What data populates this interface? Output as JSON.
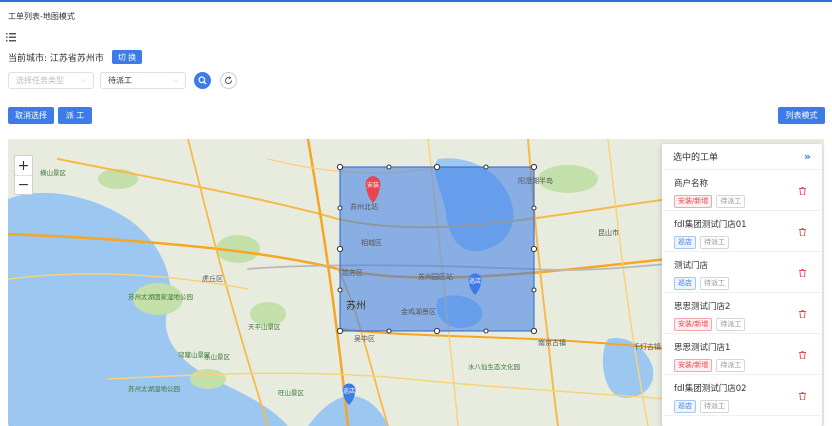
{
  "breadcrumb": "工单列表-地图模式",
  "city": {
    "label": "当前城市: 江苏省苏州市",
    "switch_label": "切 换"
  },
  "filters": {
    "task_type_placeholder": "选择任务类型",
    "status_value": "待派工"
  },
  "actions": {
    "cancel_select": "取消选择",
    "dispatch": "派 工",
    "list_mode": "列表模式"
  },
  "map": {
    "pins": [
      {
        "label": "安装",
        "color": "#e8454f"
      },
      {
        "label": "巡店",
        "color": "#3c7be8"
      },
      {
        "label": "巡店",
        "color": "#3c7be8"
      }
    ],
    "places": [
      "苏州北站",
      "相城区",
      "姑苏区",
      "苏州园区站",
      "金鸡湖景区",
      "苏州",
      "吴中区",
      "东山景区",
      "苏州太湖国家湿地公园",
      "旺山景区",
      "阳澄湖半岛",
      "昆山市",
      "虎丘区",
      "南京古镇",
      "千灯古镇",
      "水八仙生态文化园",
      "横山景区",
      "苏州太湖湿地公园",
      "穹窿山景区",
      "天平山景区"
    ],
    "zoom_in": "+",
    "zoom_out": "−"
  },
  "panel": {
    "title": "选中的工单",
    "items": [
      {
        "name": "商户名称",
        "tag": "安装/新增",
        "tag_color": "red",
        "status": "待派工"
      },
      {
        "name": "fdl集团测试门店01",
        "tag": "巡店",
        "tag_color": "blue",
        "status": "待派工"
      },
      {
        "name": "测试门店",
        "tag": "巡店",
        "tag_color": "blue",
        "status": "待派工"
      },
      {
        "name": "思思测试门店2",
        "tag": "安装/新增",
        "tag_color": "red",
        "status": "待派工"
      },
      {
        "name": "思思测试门店1",
        "tag": "安装/新增",
        "tag_color": "red",
        "status": "待派工"
      },
      {
        "name": "fdl集团测试门店02",
        "tag": "巡店",
        "tag_color": "blue",
        "status": "待派工"
      }
    ]
  }
}
